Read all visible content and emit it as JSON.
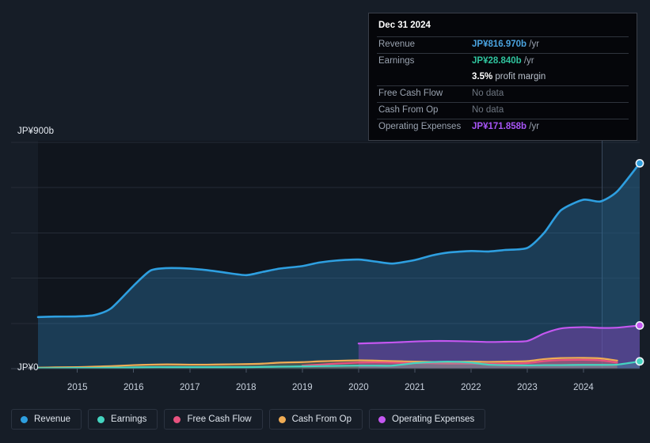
{
  "chart_data": {
    "type": "area",
    "title": "",
    "xlabel": "",
    "ylabel": "",
    "currency": "JP¥",
    "unit": "b",
    "ylim": [
      0,
      900
    ],
    "y_axis_top_label": "JP¥900b",
    "y_axis_zero_label": "JP¥0",
    "gridlines": [
      0,
      180,
      360,
      540,
      720,
      900
    ],
    "grid": true,
    "legend_position": "bottom-left",
    "x_tick_labels": [
      "2015",
      "2016",
      "2017",
      "2018",
      "2019",
      "2020",
      "2021",
      "2022",
      "2023",
      "2024"
    ],
    "x": [
      2014.3,
      2014.6,
      2015.0,
      2015.3,
      2015.6,
      2016.0,
      2016.3,
      2016.6,
      2017.0,
      2017.3,
      2017.6,
      2018.0,
      2018.3,
      2018.6,
      2019.0,
      2019.3,
      2019.6,
      2020.0,
      2020.3,
      2020.6,
      2021.0,
      2021.3,
      2021.6,
      2022.0,
      2022.3,
      2022.6,
      2023.0,
      2023.3,
      2023.6,
      2024.0,
      2024.3,
      2024.6,
      2025.0
    ],
    "forecast_boundary_x": 2024.33,
    "series": [
      {
        "name": "Revenue",
        "color": "#2e9fe0",
        "fill": "rgba(45,120,170,0.40)",
        "values": [
          205,
          207,
          208,
          213,
          240,
          330,
          390,
          400,
          398,
          392,
          383,
          372,
          385,
          398,
          408,
          422,
          430,
          434,
          426,
          418,
          432,
          450,
          462,
          468,
          466,
          472,
          480,
          540,
          630,
          672,
          665,
          705,
          817
        ]
      },
      {
        "name": "Earnings",
        "color": "#44d4c0",
        "fill": "rgba(68,212,192,0.22)",
        "values": [
          2,
          2,
          3,
          3,
          4,
          5,
          6,
          6,
          6,
          6,
          6,
          6,
          7,
          8,
          9,
          10,
          11,
          12,
          12,
          12,
          22,
          26,
          28,
          24,
          16,
          14,
          13,
          14,
          14,
          15,
          15,
          16,
          28.84
        ]
      },
      {
        "name": "Free Cash Flow",
        "color": "#e8527f",
        "fill": "rgba(232,82,127,0.22)",
        "values": [
          null,
          null,
          null,
          null,
          null,
          null,
          null,
          null,
          null,
          null,
          null,
          null,
          null,
          null,
          12,
          16,
          20,
          24,
          25,
          24,
          22,
          21,
          20,
          20,
          19,
          20,
          22,
          30,
          34,
          35,
          33,
          24,
          null
        ]
      },
      {
        "name": "Cash From Op",
        "color": "#f0ac54",
        "fill": "rgba(240,172,84,0.22)",
        "values": [
          4,
          5,
          6,
          8,
          10,
          14,
          16,
          17,
          16,
          16,
          17,
          18,
          20,
          24,
          26,
          29,
          31,
          33,
          32,
          30,
          28,
          27,
          27,
          28,
          27,
          28,
          30,
          38,
          42,
          43,
          41,
          32,
          null
        ]
      },
      {
        "name": "Operating Expenses",
        "color": "#c457f0",
        "fill": "rgba(120,70,175,0.55)",
        "values": [
          null,
          null,
          null,
          null,
          null,
          null,
          null,
          null,
          null,
          null,
          null,
          null,
          null,
          null,
          null,
          null,
          null,
          100,
          102,
          104,
          108,
          110,
          110,
          108,
          106,
          107,
          110,
          140,
          160,
          165,
          162,
          163,
          171.858
        ]
      }
    ],
    "end_markers": [
      {
        "series": "Revenue",
        "value": 816.97,
        "color": "#2e9fe0"
      },
      {
        "series": "Operating Expenses",
        "value": 171.858,
        "color": "#c457f0"
      },
      {
        "series": "Earnings",
        "value": 28.84,
        "color": "#44d4c0"
      }
    ]
  },
  "tooltip": {
    "date": "Dec 31 2024",
    "rows": [
      {
        "label": "Revenue",
        "value": "JP¥816.970b",
        "unit": "/yr",
        "color": "#4aa3df",
        "has_data": true
      },
      {
        "label": "Earnings",
        "value": "JP¥28.840b",
        "unit": "/yr",
        "color": "#2fc49e",
        "has_data": true
      },
      {
        "label": "",
        "value": "3.5%",
        "unit": "profit margin",
        "color": "#ffffff",
        "has_data": true,
        "is_margin": true
      },
      {
        "label": "Free Cash Flow",
        "value": "No data",
        "unit": "",
        "color": "#6e7681",
        "has_data": false
      },
      {
        "label": "Cash From Op",
        "value": "No data",
        "unit": "",
        "color": "#6e7681",
        "has_data": false
      },
      {
        "label": "Operating Expenses",
        "value": "JP¥171.858b",
        "unit": "/yr",
        "color": "#a855f7",
        "has_data": true
      }
    ]
  },
  "legend": {
    "items": [
      {
        "label": "Revenue",
        "color": "#2e9fe0"
      },
      {
        "label": "Earnings",
        "color": "#44d4c0"
      },
      {
        "label": "Free Cash Flow",
        "color": "#e8527f"
      },
      {
        "label": "Cash From Op",
        "color": "#f0ac54"
      },
      {
        "label": "Operating Expenses",
        "color": "#c457f0"
      }
    ]
  },
  "colors": {
    "background": "#161d27",
    "plot_background": "#10151d",
    "gridline": "#252c37",
    "axis_text": "#c9d2de"
  }
}
